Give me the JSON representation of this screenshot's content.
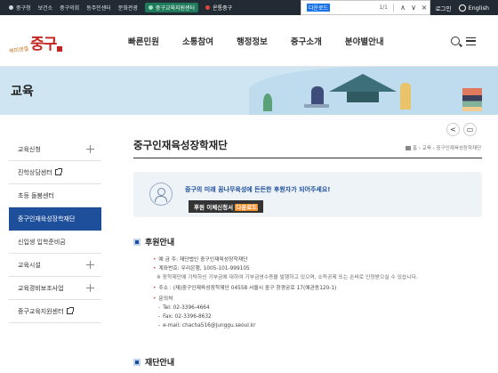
{
  "topbar": {
    "links": [
      "중구청",
      "보건소",
      "중구의회",
      "동주민센터",
      "문화관광",
      "중구교육지원센터",
      "온통중구"
    ],
    "login": "로그인",
    "language": "English"
  },
  "findbar": {
    "query": "다운로드",
    "count": "1/1",
    "prev": "∧",
    "next": "∨",
    "close": "×"
  },
  "header": {
    "logo_slogan": "해피엔젤",
    "logo_name": "중구",
    "nav": [
      "빠른민원",
      "소통참여",
      "행정정보",
      "중구소개",
      "분야별안내"
    ]
  },
  "banner": {
    "title": "교육"
  },
  "sidebar": {
    "items": [
      {
        "label": "교육신청"
      },
      {
        "label": "진학상담센터"
      },
      {
        "label": "초등 돌봄센터"
      },
      {
        "label": "중구인재육성장학재단"
      },
      {
        "label": "신입생 입학준비금"
      },
      {
        "label": "교육시설"
      },
      {
        "label": "교육경비보조사업"
      },
      {
        "label": "중구교육지원센터"
      }
    ]
  },
  "content": {
    "title": "중구인재육성장학재단",
    "breadcrumb": "홈 › 교육 › 중구인재육성장학재단",
    "notice": {
      "message": "중구의 미래 꿈나무육성에 든든한 후원자가 되어주세요!",
      "button_prefix": "후원 이체신청서 ",
      "button_highlight": "다운로드"
    },
    "section1": "후원안내",
    "section2": "재단안내",
    "info": {
      "holder": "예 금 주: 재단법인 중구인재육성장학재단",
      "account": "계좌번호: 우리은행, 1005-101-999105",
      "note": "※ 장학재단에 기탁하신 기부금에 대하여 기부금영수증을 발행하고 있으며, 소득공제 또는 손비로 인정받으실 수 있습니다.",
      "address": "주소 : (재)중구인재육성장학재단 04558 서울시 중구 창경궁로 17(예관동120-1)",
      "contact_label": "문의처",
      "tel": "Tel: 02-3396-4664",
      "fax": "Fax: 02-3396-8632",
      "email": "e-mail: chacha516@junggu.seoul.kr"
    }
  }
}
